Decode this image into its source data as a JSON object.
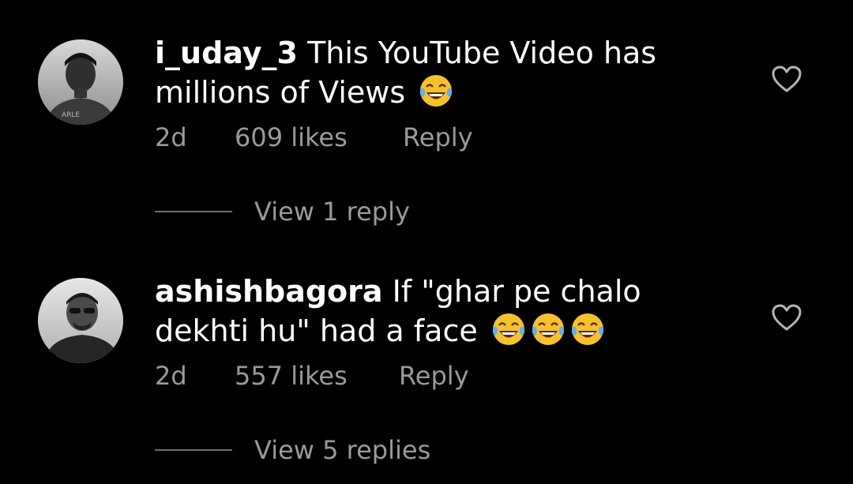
{
  "theme": {
    "background": "#000000",
    "text": "#ffffff",
    "secondary_text": "#9a9a9a"
  },
  "comments": [
    {
      "username": "i_uday_3",
      "text": "This YouTube Video has millions of Views",
      "emoji": [
        "face-with-tears-of-joy"
      ],
      "time": "2d",
      "likes": "609 likes",
      "reply_label": "Reply",
      "view_replies": "View 1 reply",
      "like_icon": "heart-outline-icon"
    },
    {
      "username": "ashishbagora",
      "text": "If \"ghar pe chalo dekhti hu\" had a face",
      "emoji": [
        "face-with-tears-of-joy",
        "face-with-tears-of-joy",
        "face-with-tears-of-joy"
      ],
      "time": "2d",
      "likes": "557 likes",
      "reply_label": "Reply",
      "view_replies": "View 5 replies",
      "like_icon": "heart-outline-icon"
    }
  ]
}
